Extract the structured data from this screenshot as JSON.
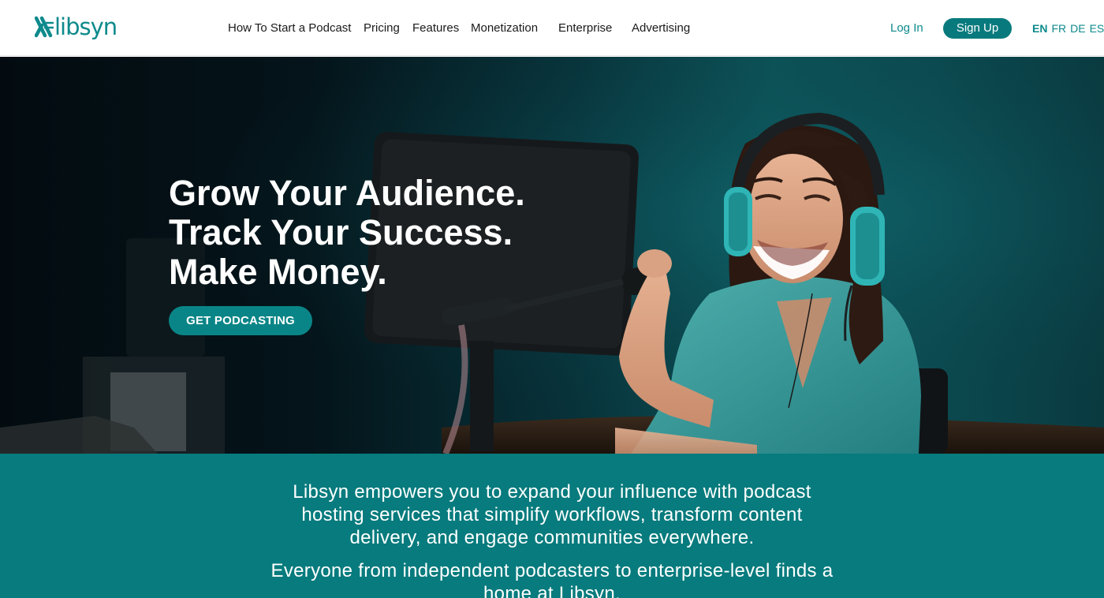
{
  "brand": {
    "name": "libsyn",
    "color": "#0e8a8c"
  },
  "nav": {
    "items": [
      "How To Start a Podcast",
      "Pricing",
      "Features",
      "Monetization",
      "Enterprise",
      "Advertising"
    ]
  },
  "account": {
    "login_label": "Log In",
    "signup_label": "Sign Up"
  },
  "languages": {
    "items": [
      "EN",
      "FR",
      "DE",
      "ES"
    ],
    "active": "EN"
  },
  "hero": {
    "lines": [
      "Grow Your Audience.",
      "Track Your Success.",
      "Make Money."
    ],
    "cta_label": "GET PODCASTING"
  },
  "intro": {
    "paragraph_1": "Libsyn empowers you to expand your influence with podcast hosting services that simplify workflows, transform content delivery, and engage communities everywhere.",
    "paragraph_2": "Everyone from independent podcasters to enterprise-level finds a home at Libsyn."
  },
  "colors": {
    "accent": "#087a7d",
    "band": "#077b7d",
    "link": "#0e8a8c"
  }
}
